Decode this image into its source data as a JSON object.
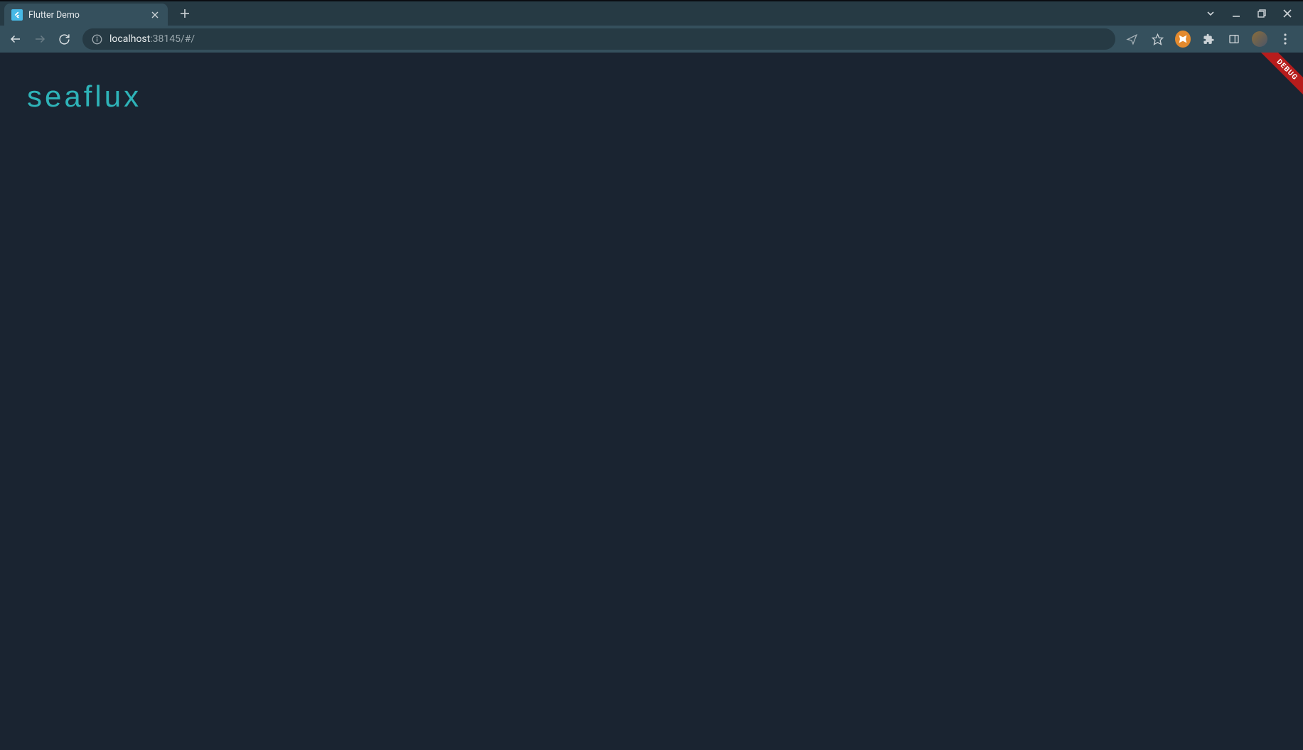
{
  "browser": {
    "tab": {
      "title": "Flutter Demo"
    },
    "url": {
      "host": "localhost",
      "rest": ":38145/#/"
    }
  },
  "page": {
    "logo_text": "seaflux",
    "debug_banner": "DEBUG"
  }
}
